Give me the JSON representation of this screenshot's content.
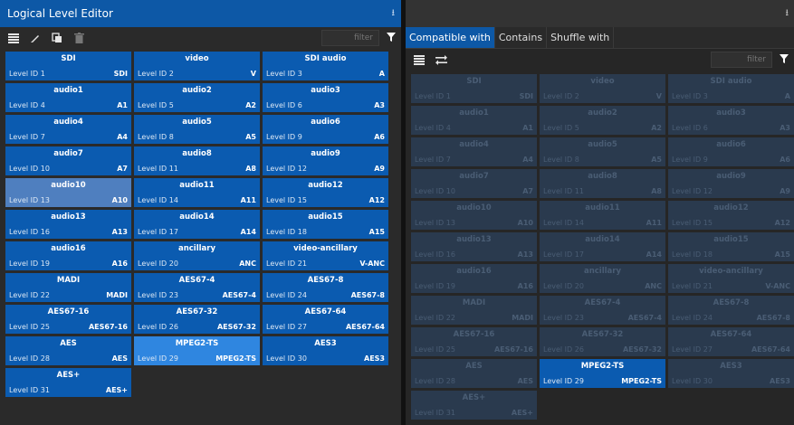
{
  "left_panel": {
    "title": "Logical Level Editor",
    "pin_icon": "pin-icon",
    "toolbar": {
      "icons": [
        "list-icon",
        "edit-icon",
        "duplicate-icon",
        "delete-icon"
      ],
      "filter_placeholder": "filter",
      "filter_icon": "funnel-icon"
    }
  },
  "right_panel": {
    "pin_icon": "pin-icon",
    "tabs": [
      {
        "label": "Compatible with",
        "active": true
      },
      {
        "label": "Contains",
        "active": false
      },
      {
        "label": "Shuffle with",
        "active": false
      }
    ],
    "toolbar": {
      "icons": [
        "list-icon",
        "shuffle-icon"
      ],
      "filter_placeholder": "filter",
      "filter_icon": "funnel-icon"
    },
    "active_level": "Level ID 29"
  },
  "levels": [
    {
      "name": "SDI",
      "id": "Level ID 1",
      "abbr": "SDI"
    },
    {
      "name": "video",
      "id": "Level ID 2",
      "abbr": "V"
    },
    {
      "name": "SDI audio",
      "id": "Level ID 3",
      "abbr": "A"
    },
    {
      "name": "audio1",
      "id": "Level ID 4",
      "abbr": "A1"
    },
    {
      "name": "audio2",
      "id": "Level ID 5",
      "abbr": "A2"
    },
    {
      "name": "audio3",
      "id": "Level ID 6",
      "abbr": "A3"
    },
    {
      "name": "audio4",
      "id": "Level ID 7",
      "abbr": "A4"
    },
    {
      "name": "audio5",
      "id": "Level ID 8",
      "abbr": "A5"
    },
    {
      "name": "audio6",
      "id": "Level ID 9",
      "abbr": "A6"
    },
    {
      "name": "audio7",
      "id": "Level ID 10",
      "abbr": "A7"
    },
    {
      "name": "audio8",
      "id": "Level ID 11",
      "abbr": "A8"
    },
    {
      "name": "audio9",
      "id": "Level ID 12",
      "abbr": "A9"
    },
    {
      "name": "audio10",
      "id": "Level ID 13",
      "abbr": "A10",
      "state": "selected"
    },
    {
      "name": "audio11",
      "id": "Level ID 14",
      "abbr": "A11"
    },
    {
      "name": "audio12",
      "id": "Level ID 15",
      "abbr": "A12"
    },
    {
      "name": "audio13",
      "id": "Level ID 16",
      "abbr": "A13"
    },
    {
      "name": "audio14",
      "id": "Level ID 17",
      "abbr": "A14"
    },
    {
      "name": "audio15",
      "id": "Level ID 18",
      "abbr": "A15"
    },
    {
      "name": "audio16",
      "id": "Level ID 19",
      "abbr": "A16"
    },
    {
      "name": "ancillary",
      "id": "Level ID 20",
      "abbr": "ANC"
    },
    {
      "name": "video-ancillary",
      "id": "Level ID 21",
      "abbr": "V-ANC"
    },
    {
      "name": "MADI",
      "id": "Level ID 22",
      "abbr": "MADI"
    },
    {
      "name": "AES67-4",
      "id": "Level ID 23",
      "abbr": "AES67-4"
    },
    {
      "name": "AES67-8",
      "id": "Level ID 24",
      "abbr": "AES67-8"
    },
    {
      "name": "AES67-16",
      "id": "Level ID 25",
      "abbr": "AES67-16"
    },
    {
      "name": "AES67-32",
      "id": "Level ID 26",
      "abbr": "AES67-32"
    },
    {
      "name": "AES67-64",
      "id": "Level ID 27",
      "abbr": "AES67-64"
    },
    {
      "name": "AES",
      "id": "Level ID 28",
      "abbr": "AES"
    },
    {
      "name": "MPEG2-TS",
      "id": "Level ID 29",
      "abbr": "MPEG2-TS",
      "state": "highlighted"
    },
    {
      "name": "AES3",
      "id": "Level ID 30",
      "abbr": "AES3"
    },
    {
      "name": "AES+",
      "id": "Level ID 31",
      "abbr": "AES+"
    }
  ],
  "colors": {
    "accent": "#0d58a6",
    "tile": "#0b5bb0",
    "tile_selected": "#4f7fbf",
    "tile_highlighted": "#2f86e0",
    "tile_disabled": "#2a3a4e"
  }
}
